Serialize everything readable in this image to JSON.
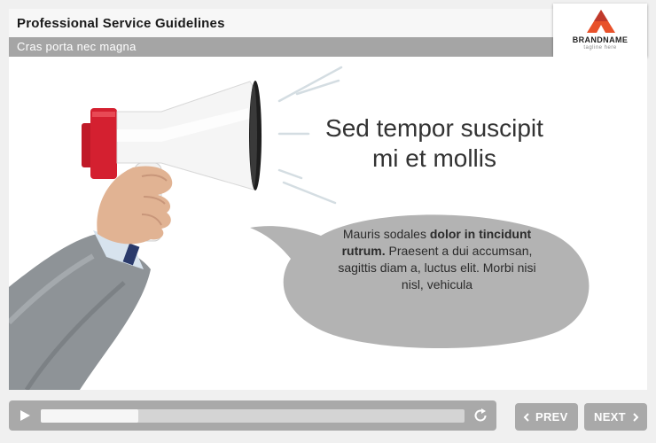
{
  "header": {
    "title": "Professional Service Guidelines",
    "subtitle": "Cras porta nec magna"
  },
  "logo": {
    "name": "BRANDNAME",
    "tagline": "tagline here",
    "accent": "#e8512a"
  },
  "slide": {
    "headline_line1": "Sed tempor suscipit",
    "headline_line2": "mi et mollis",
    "bubble_text_normal1": "Mauris sodales ",
    "bubble_text_bold": "dolor in tincidunt rutrum.",
    "bubble_text_normal2": " Praesent a dui accumsan, sagittis diam a, luctus elit. Morbi nisi nisl, vehicula",
    "illustration": "hand-holding-megaphone"
  },
  "player": {
    "progress": 0.23,
    "play_icon": "play-icon",
    "replay_icon": "replay-icon"
  },
  "nav": {
    "prev_label": "PREV",
    "next_label": "NEXT"
  },
  "colors": {
    "bubble": "#b3b3b3",
    "bars": "#a9a9a9",
    "megaphone_red": "#d42030"
  }
}
